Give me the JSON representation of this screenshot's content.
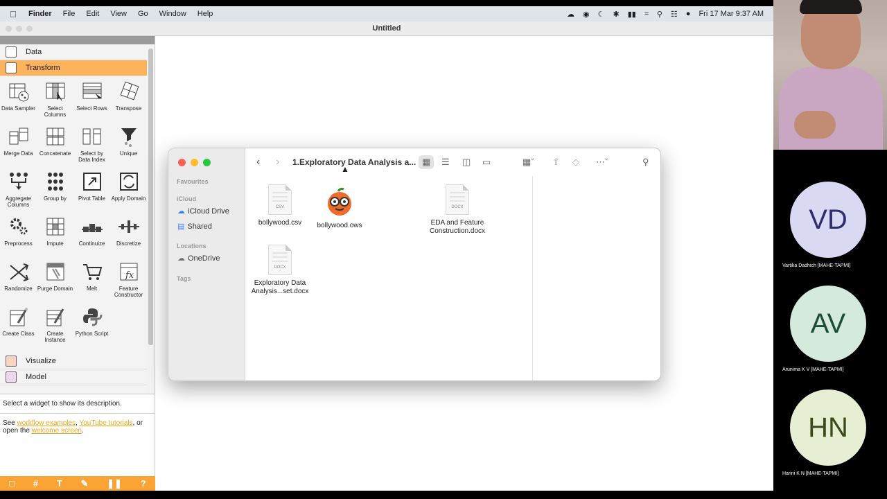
{
  "menubar": {
    "app": "Finder",
    "items": [
      "File",
      "Edit",
      "View",
      "Go",
      "Window",
      "Help"
    ],
    "datetime": "Fri 17 Mar  9:37 AM"
  },
  "orange": {
    "window_title": "Untitled",
    "categories": {
      "data": "Data",
      "transform": "Transform",
      "visualize": "Visualize",
      "model": "Model"
    },
    "widgets": [
      "Data Sampler",
      "Select Columns",
      "Select Rows",
      "Transpose",
      "Merge Data",
      "Concatenate",
      "Select by Data Index",
      "Unique",
      "Aggregate Columns",
      "Group by",
      "Pivot Table",
      "Apply Domain",
      "Preprocess",
      "Impute",
      "Continuize",
      "Discretize",
      "Randomize",
      "Purge Domain",
      "Melt",
      "Feature Constructor",
      "Create Class",
      "Create Instance",
      "Python Script"
    ],
    "description": {
      "main": "Select a widget to show its description.",
      "see": "See ",
      "link1": "workflow examples",
      "comma": ", ",
      "link2": "YouTube tutorials",
      "or": ", or",
      "open": "open the ",
      "link3": "welcome screen",
      "period": "."
    }
  },
  "finder": {
    "title": "1.Exploratory Data Analysis a...",
    "sidebar": {
      "favourites": "Favourites",
      "icloud": "iCloud",
      "icloud_drive": "iCloud Drive",
      "shared": "Shared",
      "locations": "Locations",
      "onedrive": "OneDrive",
      "tags": "Tags"
    },
    "files": [
      {
        "name": "bollywood.csv",
        "ext": "CSV"
      },
      {
        "name": "bollywood.ows",
        "ext": ""
      },
      {
        "name": "EDA and Feature Construction.docx",
        "ext": "DOCX"
      },
      {
        "name": "Exploratory Data Analysis...set.docx",
        "ext": "DOCX"
      }
    ]
  },
  "participants": [
    {
      "initials": "VD",
      "name": "Vartika Dadhich [MAHE-TAPMI]",
      "bg": "#d9d9f3",
      "fg": "#2c2c6e"
    },
    {
      "initials": "AV",
      "name": "Arunima K V [MAHE-TAPMI]",
      "bg": "#d3eadc",
      "fg": "#1f4d33"
    },
    {
      "initials": "HN",
      "name": "Harini K N [MAHE-TAPMI]",
      "bg": "#e6eed3",
      "fg": "#3a4a1a"
    }
  ]
}
